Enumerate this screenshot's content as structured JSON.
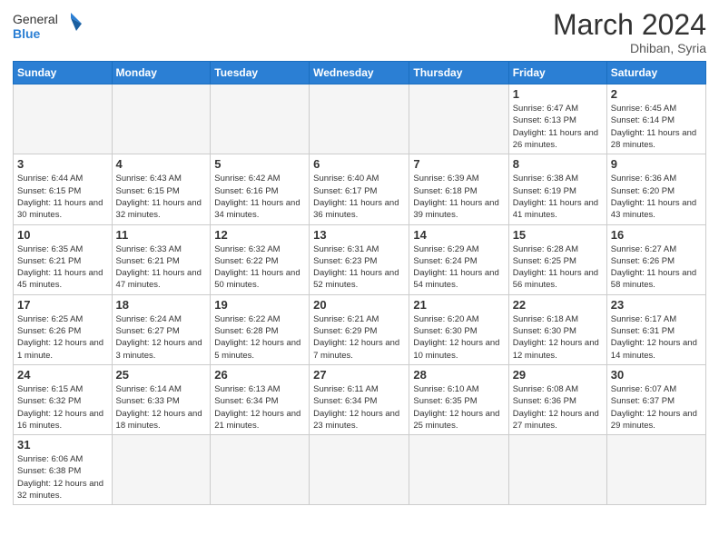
{
  "header": {
    "logo_general": "General",
    "logo_blue": "Blue",
    "month_title": "March 2024",
    "subtitle": "Dhiban, Syria"
  },
  "weekdays": [
    "Sunday",
    "Monday",
    "Tuesday",
    "Wednesday",
    "Thursday",
    "Friday",
    "Saturday"
  ],
  "weeks": [
    [
      {
        "day": "",
        "info": ""
      },
      {
        "day": "",
        "info": ""
      },
      {
        "day": "",
        "info": ""
      },
      {
        "day": "",
        "info": ""
      },
      {
        "day": "",
        "info": ""
      },
      {
        "day": "1",
        "info": "Sunrise: 6:47 AM\nSunset: 6:13 PM\nDaylight: 11 hours\nand 26 minutes."
      },
      {
        "day": "2",
        "info": "Sunrise: 6:45 AM\nSunset: 6:14 PM\nDaylight: 11 hours\nand 28 minutes."
      }
    ],
    [
      {
        "day": "3",
        "info": "Sunrise: 6:44 AM\nSunset: 6:15 PM\nDaylight: 11 hours\nand 30 minutes."
      },
      {
        "day": "4",
        "info": "Sunrise: 6:43 AM\nSunset: 6:15 PM\nDaylight: 11 hours\nand 32 minutes."
      },
      {
        "day": "5",
        "info": "Sunrise: 6:42 AM\nSunset: 6:16 PM\nDaylight: 11 hours\nand 34 minutes."
      },
      {
        "day": "6",
        "info": "Sunrise: 6:40 AM\nSunset: 6:17 PM\nDaylight: 11 hours\nand 36 minutes."
      },
      {
        "day": "7",
        "info": "Sunrise: 6:39 AM\nSunset: 6:18 PM\nDaylight: 11 hours\nand 39 minutes."
      },
      {
        "day": "8",
        "info": "Sunrise: 6:38 AM\nSunset: 6:19 PM\nDaylight: 11 hours\nand 41 minutes."
      },
      {
        "day": "9",
        "info": "Sunrise: 6:36 AM\nSunset: 6:20 PM\nDaylight: 11 hours\nand 43 minutes."
      }
    ],
    [
      {
        "day": "10",
        "info": "Sunrise: 6:35 AM\nSunset: 6:21 PM\nDaylight: 11 hours\nand 45 minutes."
      },
      {
        "day": "11",
        "info": "Sunrise: 6:33 AM\nSunset: 6:21 PM\nDaylight: 11 hours\nand 47 minutes."
      },
      {
        "day": "12",
        "info": "Sunrise: 6:32 AM\nSunset: 6:22 PM\nDaylight: 11 hours\nand 50 minutes."
      },
      {
        "day": "13",
        "info": "Sunrise: 6:31 AM\nSunset: 6:23 PM\nDaylight: 11 hours\nand 52 minutes."
      },
      {
        "day": "14",
        "info": "Sunrise: 6:29 AM\nSunset: 6:24 PM\nDaylight: 11 hours\nand 54 minutes."
      },
      {
        "day": "15",
        "info": "Sunrise: 6:28 AM\nSunset: 6:25 PM\nDaylight: 11 hours\nand 56 minutes."
      },
      {
        "day": "16",
        "info": "Sunrise: 6:27 AM\nSunset: 6:26 PM\nDaylight: 11 hours\nand 58 minutes."
      }
    ],
    [
      {
        "day": "17",
        "info": "Sunrise: 6:25 AM\nSunset: 6:26 PM\nDaylight: 12 hours\nand 1 minute."
      },
      {
        "day": "18",
        "info": "Sunrise: 6:24 AM\nSunset: 6:27 PM\nDaylight: 12 hours\nand 3 minutes."
      },
      {
        "day": "19",
        "info": "Sunrise: 6:22 AM\nSunset: 6:28 PM\nDaylight: 12 hours\nand 5 minutes."
      },
      {
        "day": "20",
        "info": "Sunrise: 6:21 AM\nSunset: 6:29 PM\nDaylight: 12 hours\nand 7 minutes."
      },
      {
        "day": "21",
        "info": "Sunrise: 6:20 AM\nSunset: 6:30 PM\nDaylight: 12 hours\nand 10 minutes."
      },
      {
        "day": "22",
        "info": "Sunrise: 6:18 AM\nSunset: 6:30 PM\nDaylight: 12 hours\nand 12 minutes."
      },
      {
        "day": "23",
        "info": "Sunrise: 6:17 AM\nSunset: 6:31 PM\nDaylight: 12 hours\nand 14 minutes."
      }
    ],
    [
      {
        "day": "24",
        "info": "Sunrise: 6:15 AM\nSunset: 6:32 PM\nDaylight: 12 hours\nand 16 minutes."
      },
      {
        "day": "25",
        "info": "Sunrise: 6:14 AM\nSunset: 6:33 PM\nDaylight: 12 hours\nand 18 minutes."
      },
      {
        "day": "26",
        "info": "Sunrise: 6:13 AM\nSunset: 6:34 PM\nDaylight: 12 hours\nand 21 minutes."
      },
      {
        "day": "27",
        "info": "Sunrise: 6:11 AM\nSunset: 6:34 PM\nDaylight: 12 hours\nand 23 minutes."
      },
      {
        "day": "28",
        "info": "Sunrise: 6:10 AM\nSunset: 6:35 PM\nDaylight: 12 hours\nand 25 minutes."
      },
      {
        "day": "29",
        "info": "Sunrise: 6:08 AM\nSunset: 6:36 PM\nDaylight: 12 hours\nand 27 minutes."
      },
      {
        "day": "30",
        "info": "Sunrise: 6:07 AM\nSunset: 6:37 PM\nDaylight: 12 hours\nand 29 minutes."
      }
    ],
    [
      {
        "day": "31",
        "info": "Sunrise: 6:06 AM\nSunset: 6:38 PM\nDaylight: 12 hours\nand 32 minutes."
      },
      {
        "day": "",
        "info": ""
      },
      {
        "day": "",
        "info": ""
      },
      {
        "day": "",
        "info": ""
      },
      {
        "day": "",
        "info": ""
      },
      {
        "day": "",
        "info": ""
      },
      {
        "day": "",
        "info": ""
      }
    ]
  ]
}
